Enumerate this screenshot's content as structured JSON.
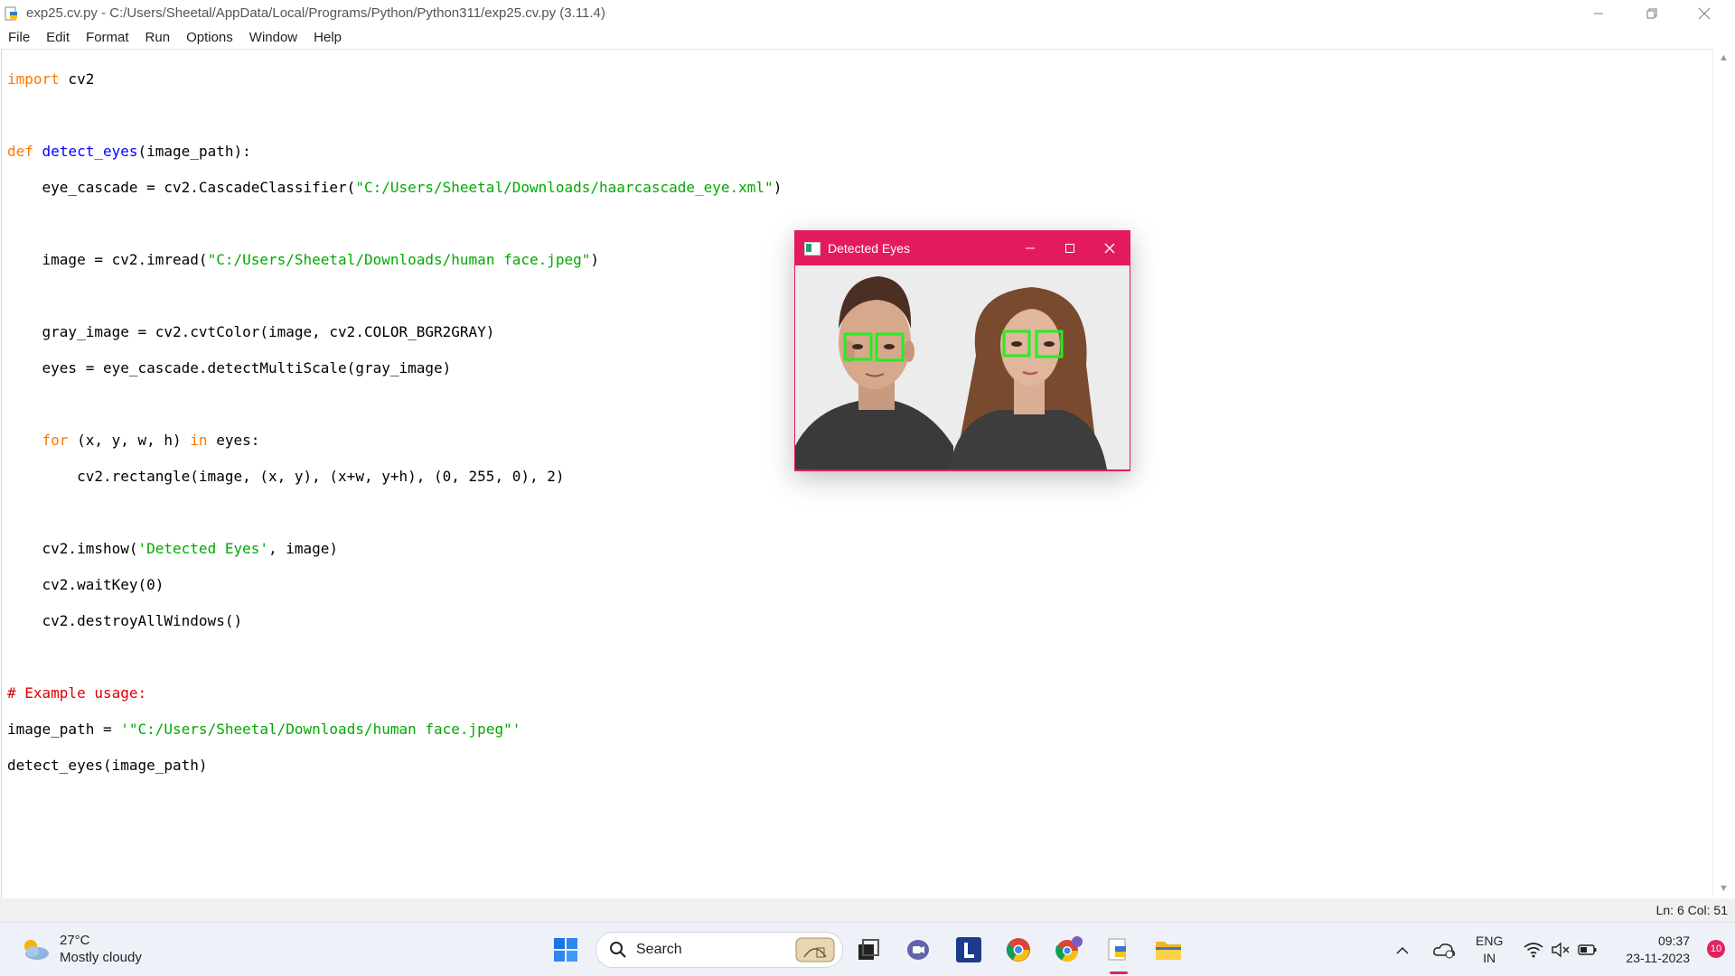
{
  "window": {
    "title": "exp25.cv.py - C:/Users/Sheetal/AppData/Local/Programs/Python/Python311/exp25.cv.py (3.11.4)",
    "controls": [
      "minimize",
      "restore",
      "close"
    ]
  },
  "menu": [
    "File",
    "Edit",
    "Format",
    "Run",
    "Options",
    "Window",
    "Help"
  ],
  "code": {
    "l1_kw": "import",
    "l1_rest": " cv2",
    "l3_kw": "def",
    "l3_fn": "detect_eyes",
    "l3_rest": "(image_path):",
    "l4_a": "    eye_cascade = cv2.CascadeClassifier(",
    "l4_str": "\"C:/Users/Sheetal/Downloads/haarcascade_eye.xml\"",
    "l4_b": ")",
    "l6_a": "    image = cv2.imread(",
    "l6_str": "\"C:/Users/Sheetal/Downloads/human face.jpeg\"",
    "l6_b": ")",
    "l8": "    gray_image = cv2.cvtColor(image, cv2.COLOR_BGR2GRAY)",
    "l9": "    eyes = eye_cascade.detectMultiScale(gray_image)",
    "l11_kw1": "for",
    "l11_a": " (x, y, w, h) ",
    "l11_kw2": "in",
    "l11_b": " eyes:",
    "l12": "        cv2.rectangle(image, (x, y), (x+w, y+h), (0, 255, 0), 2)",
    "l14_a": "    cv2.imshow(",
    "l14_str": "'Detected Eyes'",
    "l14_b": ", image)",
    "l15": "    cv2.waitKey(0)",
    "l16": "    cv2.destroyAllWindows()",
    "l18_cm": "# Example usage:",
    "l19_a": "image_path = ",
    "l19_str": "'\"C:/Users/Sheetal/Downloads/human face.jpeg\"'",
    "l20": "detect_eyes(image_path)"
  },
  "status": {
    "position": "Ln: 6   Col: 51"
  },
  "popup": {
    "title": "Detected Eyes",
    "rect_color": "#22ee22",
    "accent": "#e31b5c"
  },
  "taskbar": {
    "weather_temp": "27°C",
    "weather_desc": "Mostly cloudy",
    "search_label": "Search",
    "lang_line1": "ENG",
    "lang_line2": "IN",
    "time": "09:37",
    "date": "23-11-2023",
    "notif_count": "10"
  }
}
